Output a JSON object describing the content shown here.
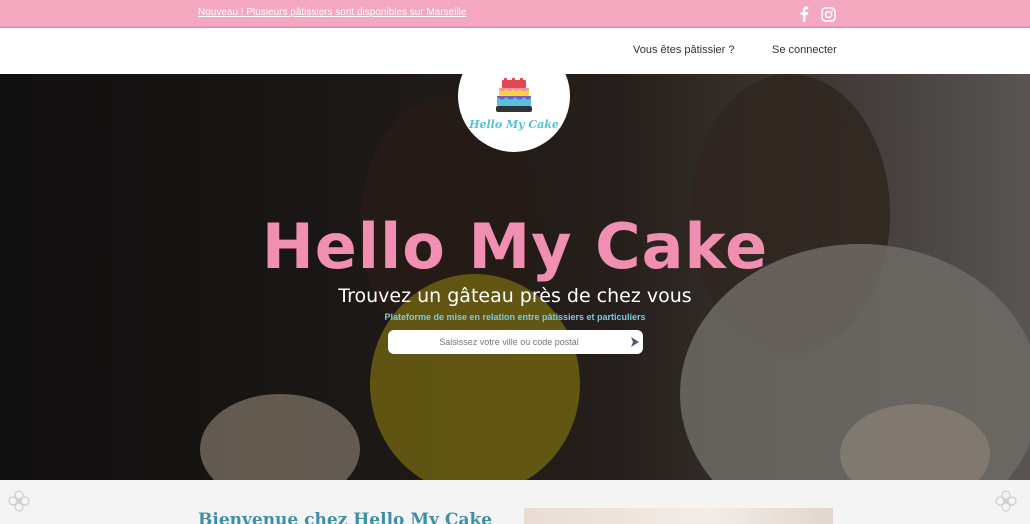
{
  "topbar": {
    "announcement": "Nouveau ! Plusieurs pâtissiers sont disponibles sur Marseille",
    "social": [
      "facebook-icon",
      "instagram-icon"
    ],
    "color": "#f3a8c0"
  },
  "nav": {
    "patissier_link": "Vous êtes pâtissier ?",
    "login_link": "Se connecter"
  },
  "logo": {
    "text": "Hello My Cake"
  },
  "hero": {
    "title": "Hello My Cake",
    "subtitle": "Trouvez un gâteau près de chez vous",
    "tagline": "Plateforme de mise en relation entre pâtissiers et particuliers",
    "search_placeholder": "Saisissez votre ville ou code postal",
    "title_color": "#f08fb2",
    "tagline_color": "#7ec8e3"
  },
  "welcome": {
    "heading": "Bienvenue chez Hello My Cake"
  }
}
